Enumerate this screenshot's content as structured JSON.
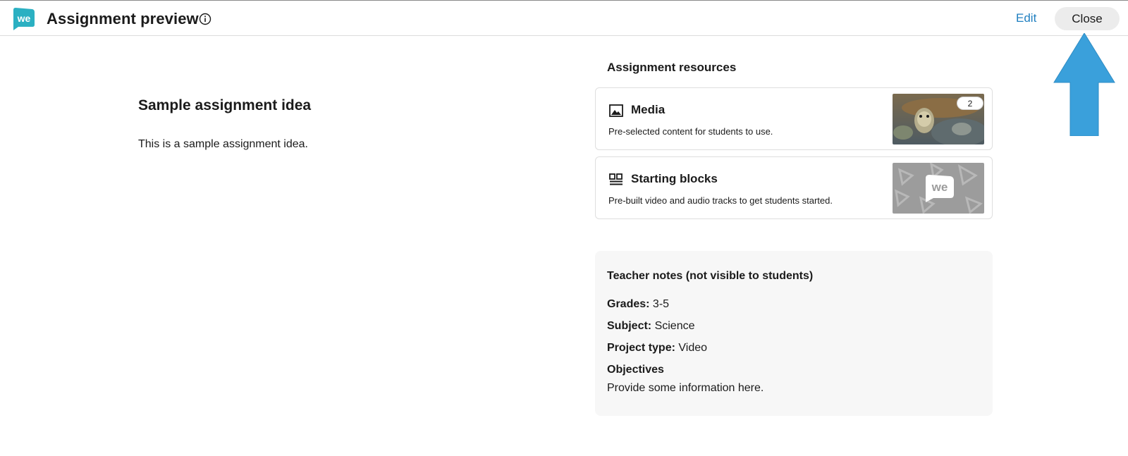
{
  "header": {
    "title": "Assignment preview",
    "edit_label": "Edit",
    "close_label": "Close",
    "logo_text": "we",
    "icons": {
      "logo": "wevideo-logo-icon",
      "info": "info-icon"
    },
    "brand_color": "#2bb0c2",
    "link_color": "#1f7fc0"
  },
  "annotation": {
    "arrow_color": "#3aa0db",
    "arrow_icon": "up-arrow-icon"
  },
  "assignment": {
    "title": "Sample assignment idea",
    "description": "This is a sample assignment idea."
  },
  "resources": {
    "heading": "Assignment resources",
    "items": [
      {
        "title": "Media",
        "description": "Pre-selected content for students to use.",
        "icon": "image-icon",
        "count": "2"
      },
      {
        "title": "Starting blocks",
        "description": "Pre-built video and audio tracks to get students started.",
        "icon": "blocks-icon",
        "thumb_logo": "we"
      }
    ]
  },
  "notes": {
    "heading": "Teacher notes (not visible to students)",
    "grades_label": "Grades:",
    "grades_value": "3-5",
    "subject_label": "Subject:",
    "subject_value": "Science",
    "project_type_label": "Project type:",
    "project_type_value": "Video",
    "objectives_label": "Objectives",
    "objectives_value": "Provide some information here."
  }
}
